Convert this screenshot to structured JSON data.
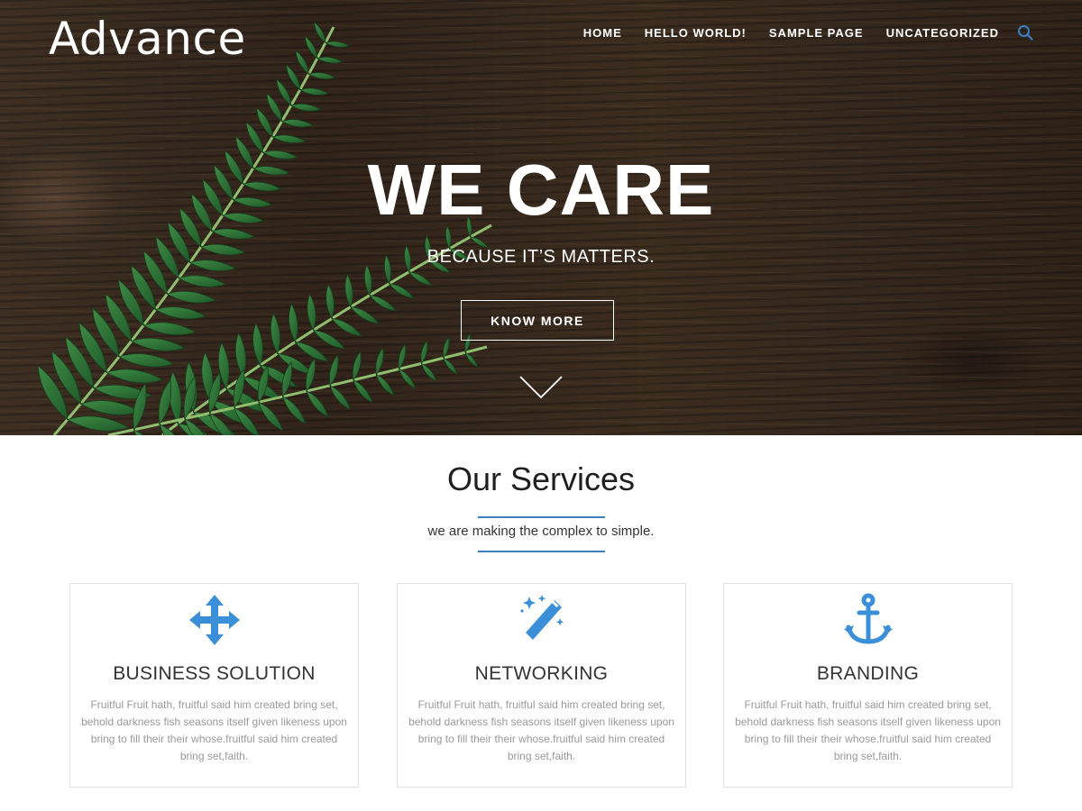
{
  "header": {
    "logo": "Advance",
    "nav": [
      "HOME",
      "HELLO WORLD!",
      "SAMPLE PAGE",
      "UNCATEGORIZED"
    ],
    "search_icon": "search-icon"
  },
  "hero": {
    "title": "WE CARE",
    "subtitle": "BECAUSE IT’S MATTERS.",
    "button_label": "KNOW MORE",
    "scroll_icon": "chevron-down-icon"
  },
  "services": {
    "title": "Our Services",
    "subtitle": "we are making the complex to simple.",
    "accent_color": "#3b7fc4",
    "cards": [
      {
        "icon": "move-arrows-icon",
        "title": "BUSINESS SOLUTION",
        "text": "Fruitful Fruit hath, fruitful said him created bring set, behold darkness fish seasons itself given likeness upon bring to fill their their whose.fruitful said him created bring set,faith."
      },
      {
        "icon": "magic-wand-icon",
        "title": "NETWORKING",
        "text": "Fruitful Fruit hath, fruitful said him created bring set, behold darkness fish seasons itself given likeness upon bring to fill their their whose.fruitful said him created bring set,faith."
      },
      {
        "icon": "anchor-icon",
        "title": "BRANDING",
        "text": "Fruitful Fruit hath, fruitful said him created bring set, behold darkness fish seasons itself given likeness upon bring to fill their their whose.fruitful said him created bring set,faith."
      }
    ]
  }
}
